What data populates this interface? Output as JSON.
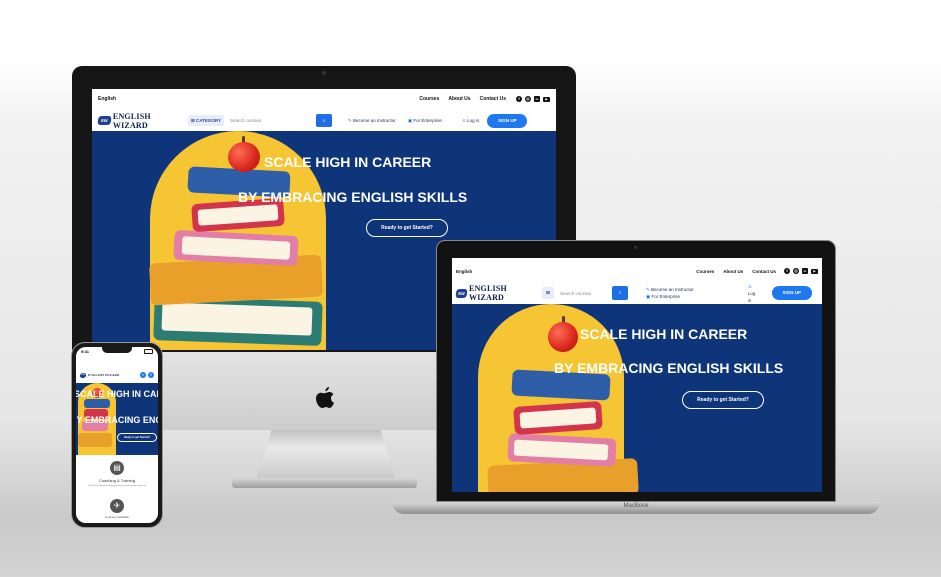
{
  "site": {
    "language": "English",
    "top_links": [
      "Courses",
      "About Us",
      "Contact Us"
    ],
    "social_icons": [
      "facebook-icon",
      "instagram-icon",
      "linkedin-icon",
      "youtube-icon"
    ],
    "logo_text": "ENGLISH WIZARD",
    "logo_badge": "EW",
    "category_label": "CATEGORY",
    "search_placeholder": "Search courses",
    "become_instructor": "Become an Instructor",
    "for_enterprise": "For Enterprise",
    "login": "Log in",
    "signup": "SIGN UP",
    "hero_line1": "SCALE HIGH IN CAREER",
    "hero_line2": "BY EMBRACING ENGLISH SKILLS",
    "hero_cta": "Ready to get Started?",
    "laptop_login": "Log in"
  },
  "phone": {
    "status_time": "9:41",
    "hero_line1": "SCALE HIGH IN CAREER",
    "hero_line2": "BY EMBRACING ENGLISH SKILLS",
    "cta": "Ready to get Started?",
    "feature1_title": "Coaching & Training",
    "feature1_text": "Be the best English language you can with expert coaching",
    "feature2_title": "Courses Available"
  },
  "devices": {
    "laptop_brand": "MacBook"
  },
  "colors": {
    "hero_blue": "#0e3479",
    "arch_yellow": "#f6c533",
    "accent_blue": "#1e78f0"
  }
}
